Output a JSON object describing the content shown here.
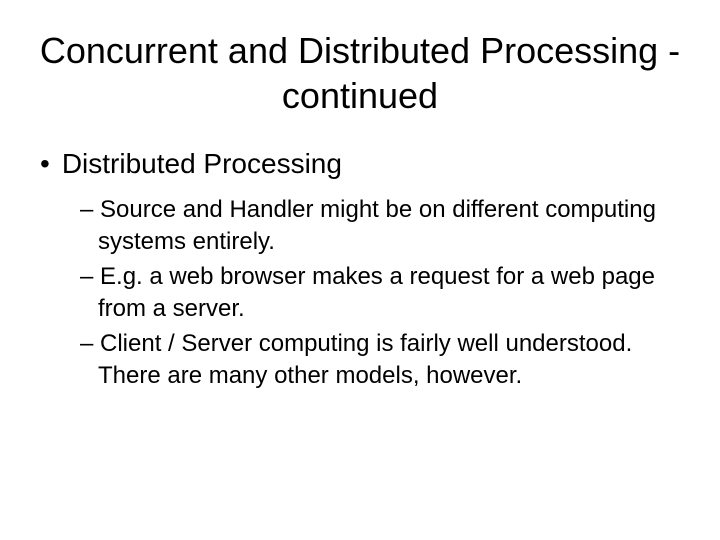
{
  "slide": {
    "title": "Concurrent and Distributed Processing - continued",
    "bullet_marker": "•",
    "bullet_text": "Distributed Processing",
    "dash1": "– Source and Handler might be on different computing systems entirely.",
    "dash2": "– E.g. a web browser makes a request for a web page from a server.",
    "dash3": "– Client / Server computing is fairly well understood.  There are many other models, however."
  }
}
